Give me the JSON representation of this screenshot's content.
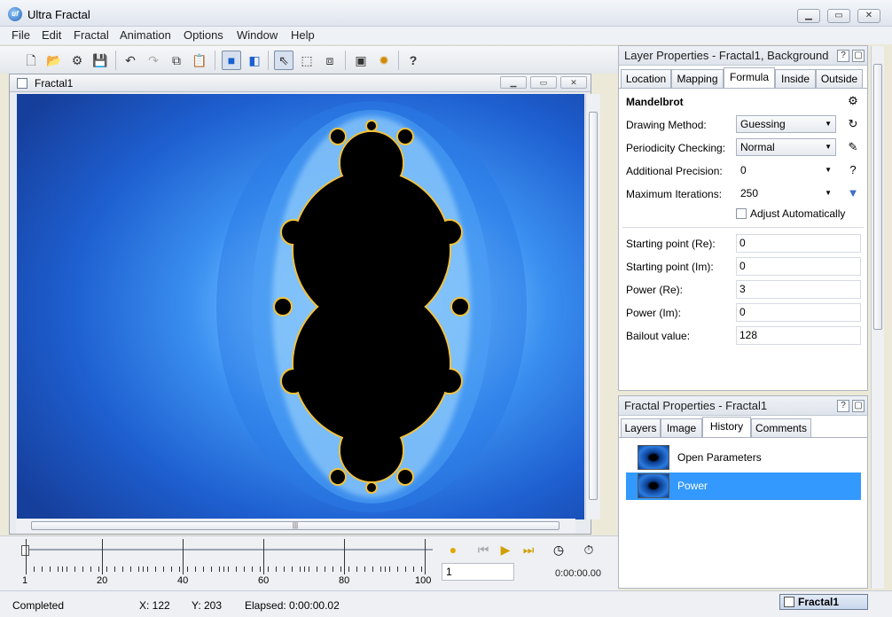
{
  "app": {
    "title": "Ultra Fractal",
    "icon_text": "uf"
  },
  "window_buttons": {
    "min": "▁",
    "max": "▭",
    "close": "✕"
  },
  "menu": [
    "File",
    "Edit",
    "Fractal",
    "Animation",
    "Options",
    "Window",
    "Help"
  ],
  "toolbar": {
    "icons": [
      "new-icon",
      "open-icon",
      "open-parameters-icon",
      "save-icon",
      "undo-icon",
      "redo-icon",
      "copy-icon",
      "paste-icon",
      "full-screen-icon",
      "switch-mode-icon",
      "select-icon",
      "zoom-select-icon",
      "layers-icon",
      "render-to-disk-icon",
      "settings-icon",
      "help-icon"
    ],
    "help_glyph": "?"
  },
  "document": {
    "title": "Fractal1"
  },
  "timeline": {
    "tick_labels": [
      "1",
      "20",
      "40",
      "60",
      "80",
      "100"
    ],
    "frame_value": "1",
    "time": "0:00:00.00"
  },
  "status": {
    "state": "Completed",
    "x": "X: 122",
    "y": "Y: 203",
    "elapsed": "Elapsed: 0:00:00.02",
    "task": "Fractal1"
  },
  "layer_props": {
    "title": "Layer Properties - Fractal1, Background",
    "tabs": [
      "Location",
      "Mapping",
      "Formula",
      "Inside",
      "Outside"
    ],
    "active_tab": "Formula",
    "formula_name": "Mandelbrot",
    "drawing_method": {
      "label": "Drawing Method:",
      "value": "Guessing"
    },
    "periodicity": {
      "label": "Periodicity Checking:",
      "value": "Normal"
    },
    "precision": {
      "label": "Additional Precision:",
      "value": "0"
    },
    "max_iter": {
      "label": "Maximum Iterations:",
      "value": "250"
    },
    "adjust": {
      "label": "Adjust Automatically",
      "checked": false
    },
    "params": [
      {
        "label": "Starting point (Re):",
        "value": "0"
      },
      {
        "label": "Starting point (Im):",
        "value": "0"
      },
      {
        "label": "Power (Re):",
        "value": "3"
      },
      {
        "label": "Power (Im):",
        "value": "0"
      },
      {
        "label": "Bailout value:",
        "value": "128"
      }
    ]
  },
  "fractal_props": {
    "title": "Fractal Properties - Fractal1",
    "tabs": [
      "Layers",
      "Image",
      "History",
      "Comments"
    ],
    "active_tab": "History",
    "history": [
      {
        "label": "Open Parameters",
        "selected": false
      },
      {
        "label": "Power",
        "selected": true
      }
    ]
  },
  "panel_buttons": {
    "help": "?",
    "pin": "▢"
  },
  "colors": {
    "selection": "#3399ff",
    "fractal_bg": "#1a5fd0",
    "fractal_edge": "#f3c23a"
  }
}
